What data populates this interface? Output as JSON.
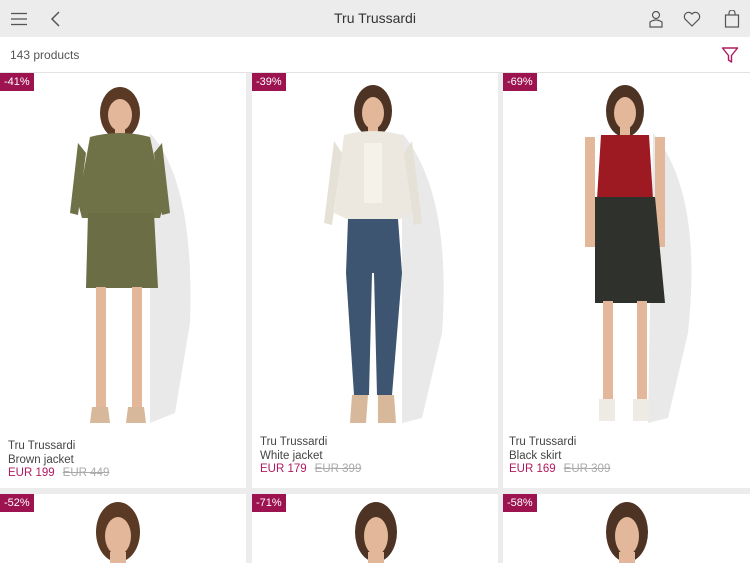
{
  "header": {
    "title": "Tru Trussardi"
  },
  "toolbar": {
    "product_count": "143 products"
  },
  "products": [
    {
      "discount": "-41%",
      "brand": "Tru Trussardi",
      "name": "Brown jacket",
      "price": "EUR 199",
      "old_price": "EUR 449"
    },
    {
      "discount": "-39%",
      "brand": "Tru Trussardi",
      "name": "White jacket",
      "price": "EUR 179",
      "old_price": "EUR 399"
    },
    {
      "discount": "-69%",
      "brand": "Tru Trussardi",
      "name": "Black skirt",
      "price": "EUR 169",
      "old_price": "EUR 309"
    },
    {
      "discount": "-52%"
    },
    {
      "discount": "-71%"
    },
    {
      "discount": "-58%"
    }
  ],
  "colors": {
    "accent": "#b01a5f",
    "badge": "#9c1350",
    "filter_icon": "#b01a5f"
  },
  "icons": [
    "menu-icon",
    "back-icon",
    "user-icon",
    "heart-icon",
    "bag-icon",
    "filter-icon"
  ]
}
